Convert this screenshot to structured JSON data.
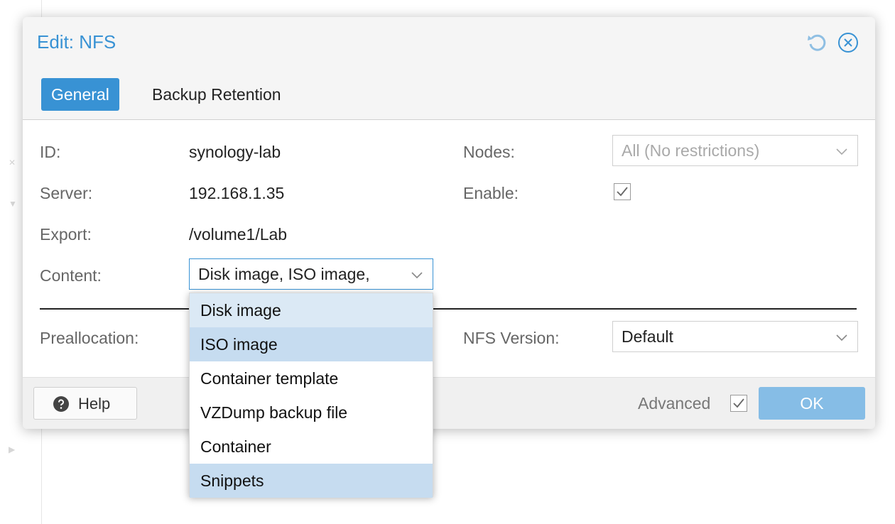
{
  "dialog": {
    "title": "Edit: NFS",
    "reset_icon": "reset-icon",
    "close_icon": "close-circle-icon"
  },
  "tabs": [
    {
      "label": "General",
      "active": true
    },
    {
      "label": "Backup Retention",
      "active": false
    }
  ],
  "form": {
    "id_label": "ID:",
    "id_value": "synology-lab",
    "server_label": "Server:",
    "server_value": "192.168.1.35",
    "export_label": "Export:",
    "export_value": "/volume1/Lab",
    "content_label": "Content:",
    "content_value": "Disk image, ISO image,",
    "nodes_label": "Nodes:",
    "nodes_value": "All (No restrictions)",
    "enable_label": "Enable:",
    "enable_checked": true,
    "preallocation_label": "Preallocation:",
    "nfs_version_label": "NFS Version:",
    "nfs_version_value": "Default"
  },
  "content_dropdown": {
    "items": [
      {
        "label": "Disk image",
        "selected": true,
        "hover": true
      },
      {
        "label": "ISO image",
        "selected": true
      },
      {
        "label": "Container template",
        "selected": false
      },
      {
        "label": "VZDump backup file",
        "selected": false
      },
      {
        "label": "Container",
        "selected": false
      },
      {
        "label": "Snippets",
        "selected": true
      }
    ]
  },
  "footer": {
    "help_label": "Help",
    "help_icon": "question-circle-icon",
    "advanced_label": "Advanced",
    "advanced_checked": true,
    "ok_label": "OK"
  },
  "colors": {
    "accent": "#3892d4",
    "ok_disabled": "#86bde6",
    "dropdown_selected": "#c6dcf0"
  }
}
